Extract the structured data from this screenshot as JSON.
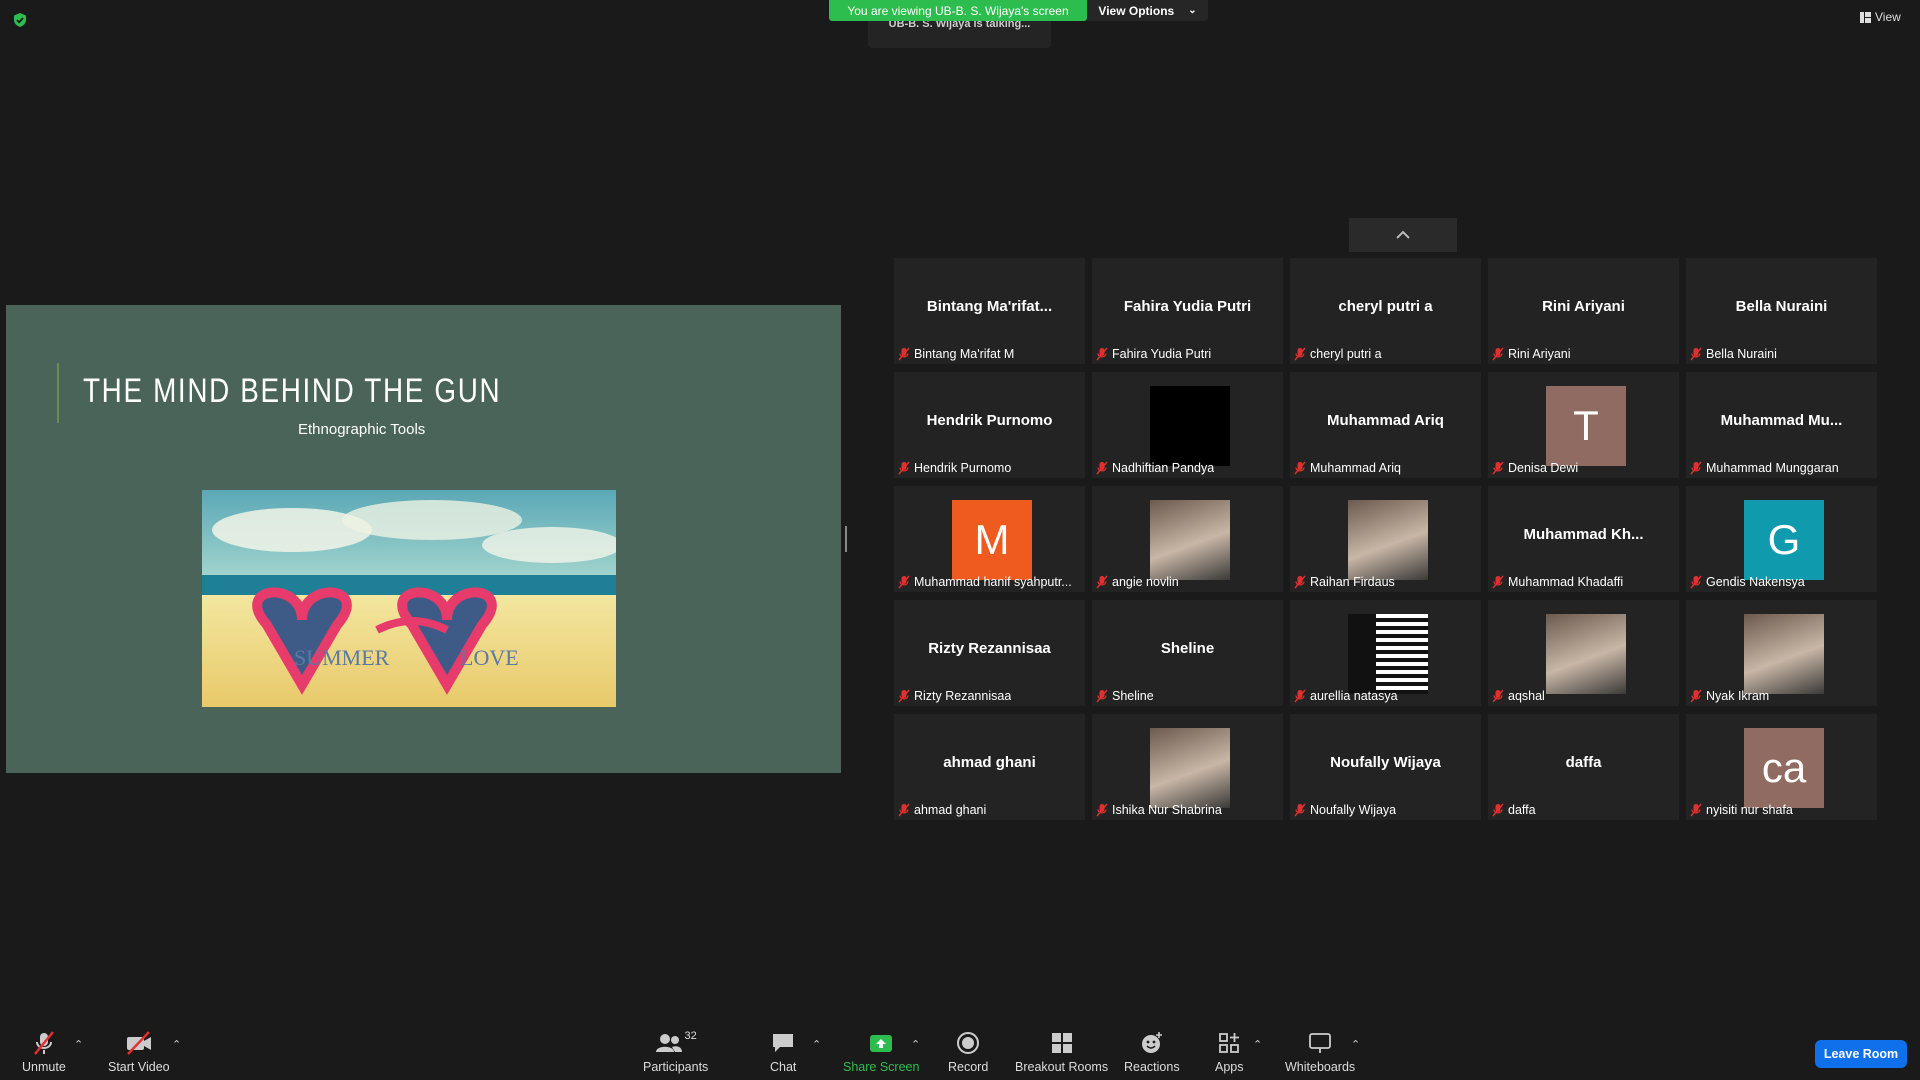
{
  "banner": {
    "viewing": "You are viewing UB-B. S. Wijaya's screen",
    "view_options": "View Options",
    "talking": "UB-B. S. Wijaya is talking..."
  },
  "top_right": {
    "view_label": "View"
  },
  "slide": {
    "title": "THE MIND BEHIND THE GUN",
    "subtitle": "Ethnographic Tools",
    "image_text_left": "SUMMER",
    "image_text_right": "LOVE"
  },
  "participants": [
    {
      "display": "Bintang  Ma'rifat...",
      "caption": "Bintang Ma'rifat M"
    },
    {
      "display": "Fahira Yudia Putri",
      "caption": "Fahira Yudia Putri"
    },
    {
      "display": "cheryl putri a",
      "caption": "cheryl putri a"
    },
    {
      "display": "Rini Ariyani",
      "caption": "Rini Ariyani"
    },
    {
      "display": "Bella Nuraini",
      "caption": "Bella Nuraini"
    },
    {
      "display": "Hendrik Purnomo",
      "caption": "Hendrik Purnomo"
    },
    {
      "display": "",
      "caption": "Nadhiftian Pandya",
      "avatar": "black"
    },
    {
      "display": "Muhammad Ariq",
      "caption": "Muhammad Ariq"
    },
    {
      "display": "T",
      "caption": "Denisa Dewi",
      "avatar": "#8f6b62"
    },
    {
      "display": "Muhammad  Mu...",
      "caption": "Muhammad Munggaran"
    },
    {
      "display": "M",
      "caption": "Muhammad hanif syahputr...",
      "avatar": "#ef5a1f"
    },
    {
      "display": "",
      "caption": "angie novlin",
      "avatar": "photo"
    },
    {
      "display": "",
      "caption": "Raihan Firdaus",
      "avatar": "photo"
    },
    {
      "display": "Muhammad  Kh...",
      "caption": "Muhammad Khadaffi"
    },
    {
      "display": "G",
      "caption": "Gendis Nakensya",
      "avatar": "#0f9aae"
    },
    {
      "display": "Rizty Rezannisaa",
      "caption": "Rizty Rezannisaa"
    },
    {
      "display": "Sheline",
      "caption": "Sheline"
    },
    {
      "display": "",
      "caption": "aurellia natasya",
      "avatar": "stripes"
    },
    {
      "display": "",
      "caption": "aqshal",
      "avatar": "photo"
    },
    {
      "display": "",
      "caption": "Nyak Ikram",
      "avatar": "photo"
    },
    {
      "display": "ahmad ghani",
      "caption": "ahmad ghani"
    },
    {
      "display": "",
      "caption": "Ishika Nur Shabrina",
      "avatar": "photo"
    },
    {
      "display": "Noufally Wijaya",
      "caption": "Noufally Wijaya"
    },
    {
      "display": "daffa",
      "caption": "daffa"
    },
    {
      "display": "ca",
      "caption": "nyisiti nur shafa",
      "avatar": "#8f6b62"
    }
  ],
  "toolbar": {
    "unmute": "Unmute",
    "start_video": "Start Video",
    "participants": "Participants",
    "participants_count": "32",
    "chat": "Chat",
    "share_screen": "Share Screen",
    "record": "Record",
    "breakout": "Breakout Rooms",
    "reactions": "Reactions",
    "apps": "Apps",
    "whiteboards": "Whiteboards",
    "leave": "Leave Room"
  },
  "colors": {
    "accent_green": "#2dbd4e",
    "leave_blue": "#0e71eb",
    "background": "#1a1a1a"
  }
}
